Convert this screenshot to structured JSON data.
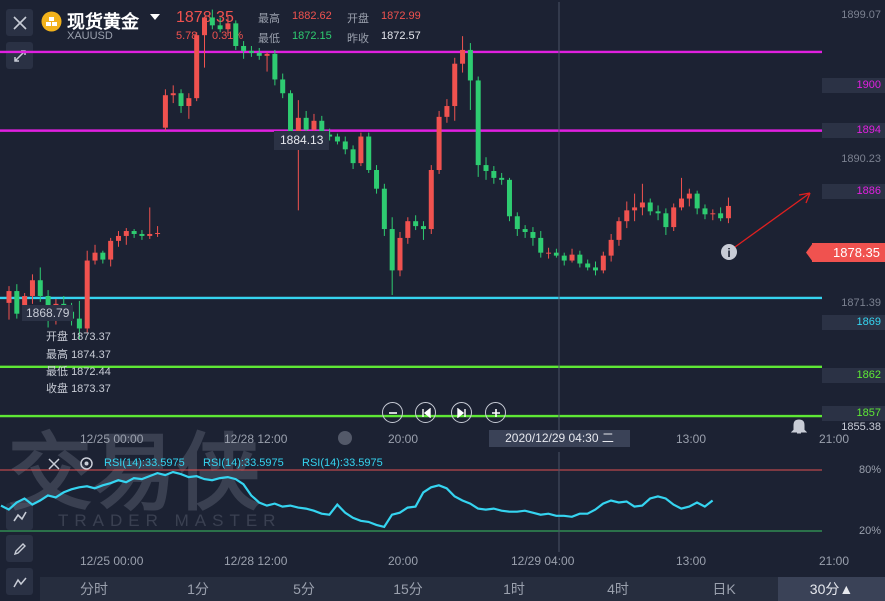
{
  "header": {
    "title": "现货黄金",
    "symbol": "XAUUSD",
    "price": "1878.35",
    "change": "5.78",
    "change_pct": "0.31%",
    "high_label": "最高",
    "high": "1882.62",
    "open_label": "开盘",
    "open": "1872.99",
    "low_label": "最低",
    "low": "1872.15",
    "prev_label": "昨收",
    "prev": "1872.57"
  },
  "crosshair": {
    "price_tag": "1884.13",
    "left_tag": "1868.79",
    "date_tag": "2020/12/29 04:30 二"
  },
  "ohlc_panel": [
    {
      "label": "开盘",
      "value": "1873.37"
    },
    {
      "label": "最高",
      "value": "1874.37"
    },
    {
      "label": "最低",
      "value": "1872.44"
    },
    {
      "label": "收盘",
      "value": "1873.37"
    }
  ],
  "y_axis": {
    "top": "1899.07",
    "mid": "1890.23",
    "low": "1871.39",
    "bottom": "1855.38",
    "current": "1878.35"
  },
  "horizontal_lines": [
    {
      "value": "1900",
      "color": "#e020e0"
    },
    {
      "value": "1894",
      "color": "#e020e0"
    },
    {
      "value": "1886",
      "color": "#e020e0"
    },
    {
      "value": "1869",
      "color": "#35d4f0"
    },
    {
      "value": "1862",
      "color": "#5ee835"
    },
    {
      "value": "1857",
      "color": "#5ee835"
    }
  ],
  "x_axis": [
    "12/25 00:00",
    "12/28 12:00",
    "20:00",
    "13:00",
    "21:00"
  ],
  "rsi": {
    "labels": [
      "RSI(14):33.5975",
      "RSI(14):33.5975",
      "RSI(14):33.5975"
    ],
    "levels": [
      "80%",
      "20%"
    ],
    "x_axis": [
      "12/25 00:00",
      "12/28 12:00",
      "20:00",
      "12/29 04:00",
      "13:00",
      "21:00"
    ]
  },
  "tabs": [
    "分时",
    "1分",
    "5分",
    "15分",
    "1时",
    "4时",
    "日K",
    "30分▲"
  ],
  "colors": {
    "up": "#f0524f",
    "down": "#2ecc71",
    "rsi": "#35d4f0",
    "background": "#1c2233"
  },
  "chart_data": {
    "type": "candlestick",
    "ylim": [
      1855.38,
      1899.07
    ],
    "candles": [
      [
        1868.5,
        1870.2,
        1866.8,
        1869.7
      ],
      [
        1869.7,
        1870.4,
        1866.9,
        1867.4
      ],
      [
        1867.4,
        1869.5,
        1866.8,
        1869.2
      ],
      [
        1869.2,
        1871.4,
        1868.4,
        1870.8
      ],
      [
        1870.8,
        1872.1,
        1868.6,
        1869.2
      ],
      [
        1869.2,
        1869.8,
        1866.0,
        1866.9
      ],
      [
        1866.9,
        1868.9,
        1866.3,
        1868.4
      ],
      [
        1868.4,
        1869.2,
        1867.2,
        1867.6
      ],
      [
        1867.6,
        1868.5,
        1866.2,
        1866.9
      ],
      [
        1866.9,
        1868.7,
        1864.8,
        1865.9
      ],
      [
        1865.9,
        1873.8,
        1865.5,
        1872.8
      ],
      [
        1872.8,
        1874.4,
        1872.4,
        1873.6
      ],
      [
        1873.6,
        1873.8,
        1872.5,
        1872.9
      ],
      [
        1872.9,
        1875.1,
        1872.2,
        1874.8
      ],
      [
        1874.8,
        1875.8,
        1874.2,
        1875.3
      ],
      [
        1875.3,
        1876.1,
        1874.4,
        1875.8
      ],
      [
        1875.8,
        1876.0,
        1875.1,
        1875.5
      ],
      [
        1875.5,
        1875.9,
        1874.9,
        1875.3
      ],
      [
        1875.3,
        1878.2,
        1875.0,
        1875.5
      ],
      [
        1875.5,
        1876.3,
        1875.2,
        1875.6
      ],
      [
        1886.3,
        1890.2,
        1886.0,
        1889.6
      ],
      [
        1889.6,
        1890.6,
        1888.8,
        1889.8
      ],
      [
        1889.8,
        1890.2,
        1887.8,
        1888.5
      ],
      [
        1888.5,
        1889.8,
        1887.2,
        1889.3
      ],
      [
        1889.3,
        1896.0,
        1889.0,
        1895.7
      ],
      [
        1895.7,
        1896.3,
        1892.4,
        1897.5
      ],
      [
        1897.5,
        1898.3,
        1896.3,
        1896.7
      ],
      [
        1896.7,
        1897.5,
        1896.0,
        1896.3
      ],
      [
        1896.3,
        1897.6,
        1895.6,
        1896.9
      ],
      [
        1896.9,
        1897.2,
        1894.2,
        1894.6
      ],
      [
        1894.6,
        1895.1,
        1893.3,
        1894.1
      ],
      [
        1894.1,
        1894.6,
        1893.5,
        1893.9
      ],
      [
        1893.9,
        1894.4,
        1893.2,
        1893.6
      ],
      [
        1893.6,
        1894.0,
        1892.0,
        1893.8
      ],
      [
        1893.8,
        1894.2,
        1890.6,
        1891.2
      ],
      [
        1891.2,
        1891.8,
        1889.3,
        1889.8
      ],
      [
        1889.8,
        1890.1,
        1884.3,
        1885.2
      ],
      [
        1885.2,
        1889.1,
        1877.9,
        1887.3
      ],
      [
        1887.3,
        1888.0,
        1885.7,
        1886.1
      ],
      [
        1886.1,
        1887.7,
        1885.6,
        1887.0
      ],
      [
        1887.0,
        1887.5,
        1885.0,
        1885.6
      ],
      [
        1885.6,
        1886.2,
        1885.0,
        1885.4
      ],
      [
        1885.4,
        1885.7,
        1884.6,
        1884.9
      ],
      [
        1884.9,
        1885.4,
        1883.6,
        1884.1
      ],
      [
        1884.1,
        1884.5,
        1882.1,
        1882.7
      ],
      [
        1882.7,
        1885.8,
        1882.4,
        1885.4
      ],
      [
        1885.4,
        1885.8,
        1881.7,
        1882.0
      ],
      [
        1882.0,
        1882.5,
        1879.6,
        1880.1
      ],
      [
        1880.1,
        1880.6,
        1875.3,
        1876.0
      ],
      [
        1876.0,
        1877.2,
        1869.3,
        1871.8
      ],
      [
        1871.8,
        1875.7,
        1871.2,
        1875.1
      ],
      [
        1875.1,
        1877.2,
        1874.5,
        1876.8
      ],
      [
        1876.8,
        1877.4,
        1875.9,
        1876.3
      ],
      [
        1876.3,
        1876.8,
        1874.9,
        1876.0
      ],
      [
        1876.0,
        1882.5,
        1875.5,
        1882.0
      ],
      [
        1882.0,
        1888.0,
        1881.6,
        1887.4
      ],
      [
        1887.4,
        1889.2,
        1886.8,
        1888.5
      ],
      [
        1888.5,
        1893.4,
        1887.0,
        1892.8
      ],
      [
        1892.8,
        1895.6,
        1891.9,
        1894.2
      ],
      [
        1894.2,
        1894.9,
        1888.1,
        1891.1
      ],
      [
        1891.1,
        1891.5,
        1881.3,
        1882.5
      ],
      [
        1882.5,
        1883.3,
        1881.0,
        1881.9
      ],
      [
        1881.9,
        1882.4,
        1880.6,
        1881.2
      ],
      [
        1881.2,
        1881.7,
        1880.5,
        1881.0
      ],
      [
        1881.0,
        1881.2,
        1876.8,
        1877.3
      ],
      [
        1877.3,
        1877.7,
        1875.3,
        1876.0
      ],
      [
        1876.0,
        1876.4,
        1875.1,
        1875.7
      ],
      [
        1875.7,
        1876.2,
        1874.3,
        1875.1
      ],
      [
        1875.1,
        1875.8,
        1873.1,
        1873.6
      ],
      [
        1873.6,
        1874.1,
        1873.0,
        1873.6
      ],
      [
        1873.6,
        1874.0,
        1873.1,
        1873.3
      ],
      [
        1873.3,
        1873.6,
        1872.3,
        1872.8
      ],
      [
        1872.8,
        1874.0,
        1872.6,
        1873.4
      ],
      [
        1873.4,
        1873.8,
        1872.1,
        1872.5
      ],
      [
        1872.5,
        1872.9,
        1871.8,
        1872.1
      ],
      [
        1872.1,
        1872.7,
        1871.3,
        1871.8
      ],
      [
        1871.8,
        1873.7,
        1871.5,
        1873.3
      ],
      [
        1873.3,
        1875.5,
        1872.7,
        1874.9
      ],
      [
        1874.9,
        1877.2,
        1874.3,
        1876.8
      ],
      [
        1876.8,
        1878.8,
        1876.1,
        1877.9
      ],
      [
        1877.9,
        1879.6,
        1876.8,
        1878.2
      ],
      [
        1878.2,
        1880.6,
        1877.4,
        1878.7
      ],
      [
        1878.7,
        1879.1,
        1877.4,
        1877.8
      ],
      [
        1877.8,
        1878.4,
        1876.9,
        1877.6
      ],
      [
        1877.6,
        1878.1,
        1875.4,
        1876.2
      ],
      [
        1876.2,
        1878.6,
        1875.8,
        1878.2
      ],
      [
        1878.2,
        1881.2,
        1877.9,
        1879.1
      ],
      [
        1879.1,
        1880.1,
        1878.3,
        1879.6
      ],
      [
        1879.6,
        1879.9,
        1877.5,
        1878.1
      ],
      [
        1878.1,
        1878.5,
        1877.0,
        1877.5
      ],
      [
        1877.5,
        1878.0,
        1876.9,
        1877.6
      ],
      [
        1877.6,
        1878.2,
        1876.8,
        1877.1
      ],
      [
        1877.1,
        1879.2,
        1876.6,
        1878.35
      ]
    ]
  }
}
